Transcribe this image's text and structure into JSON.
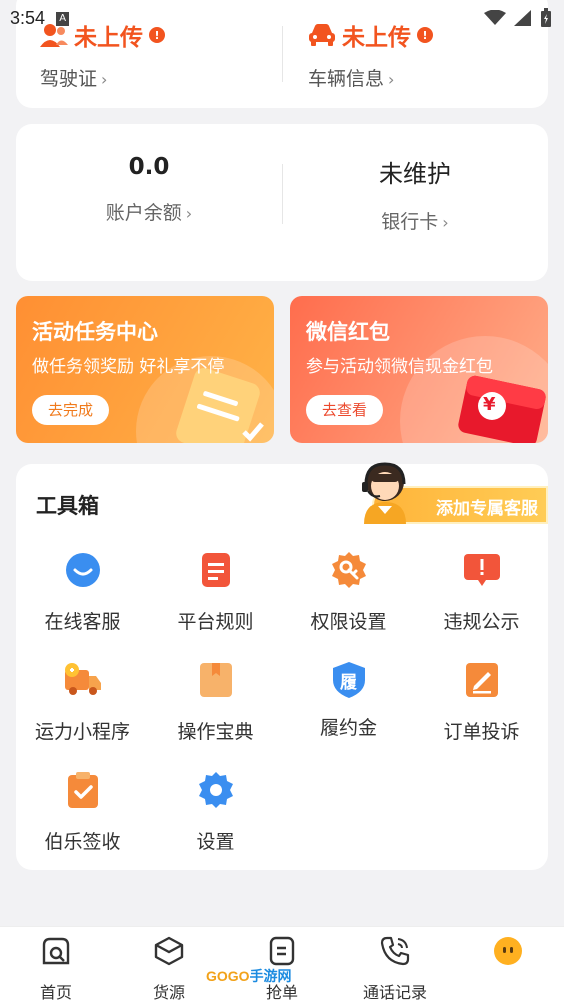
{
  "status_bar": {
    "time": "3:54",
    "notification_glyph": "A"
  },
  "profile": {
    "license": {
      "status": "未上传",
      "warn": "!",
      "label": "驾驶证"
    },
    "vehicle": {
      "status": "未上传",
      "warn": "!",
      "label": "车辆信息"
    }
  },
  "account": {
    "balance": {
      "value": "0.0",
      "label": "账户余额"
    },
    "bank": {
      "value": "未维护",
      "label": "银行卡"
    }
  },
  "promos": {
    "task": {
      "title": "活动任务中心",
      "subtitle": "做任务领奖励 好礼享不停",
      "button": "去完成"
    },
    "red_packet": {
      "title": "微信红包",
      "subtitle": "参与活动领微信现金红包",
      "button": "去查看",
      "coin": "¥"
    }
  },
  "toolbox": {
    "title": "工具箱",
    "customer_service_pill": "添加专属客服",
    "items": [
      {
        "label": "在线客服",
        "icon": "chat-bubble-icon"
      },
      {
        "label": "平台规则",
        "icon": "document-icon"
      },
      {
        "label": "权限设置",
        "icon": "key-gear-icon"
      },
      {
        "label": "违规公示",
        "icon": "alert-board-icon"
      },
      {
        "label": "运力小程序",
        "icon": "truck-icon"
      },
      {
        "label": "操作宝典",
        "icon": "book-icon"
      },
      {
        "label": "履约金",
        "icon": "shield-icon",
        "glyph": "履"
      },
      {
        "label": "订单投诉",
        "icon": "edit-icon"
      },
      {
        "label": "伯乐签收",
        "icon": "clipboard-check-icon"
      },
      {
        "label": "设置",
        "icon": "gear-icon"
      }
    ]
  },
  "bottom_nav": {
    "items": [
      {
        "label": "首页",
        "icon": "home-search-icon"
      },
      {
        "label": "货源",
        "icon": "box-icon"
      },
      {
        "label": "抢单",
        "icon": "order-icon"
      },
      {
        "label": "通话记录",
        "icon": "phone-icon"
      },
      {
        "label": "",
        "icon": "profile-face-icon"
      }
    ]
  },
  "watermark": {
    "brand": "GOGO",
    "suffix": "手游网"
  },
  "colors": {
    "accent": "#f2541f",
    "orange": "#ff8f33",
    "blue": "#3a8ef0"
  }
}
